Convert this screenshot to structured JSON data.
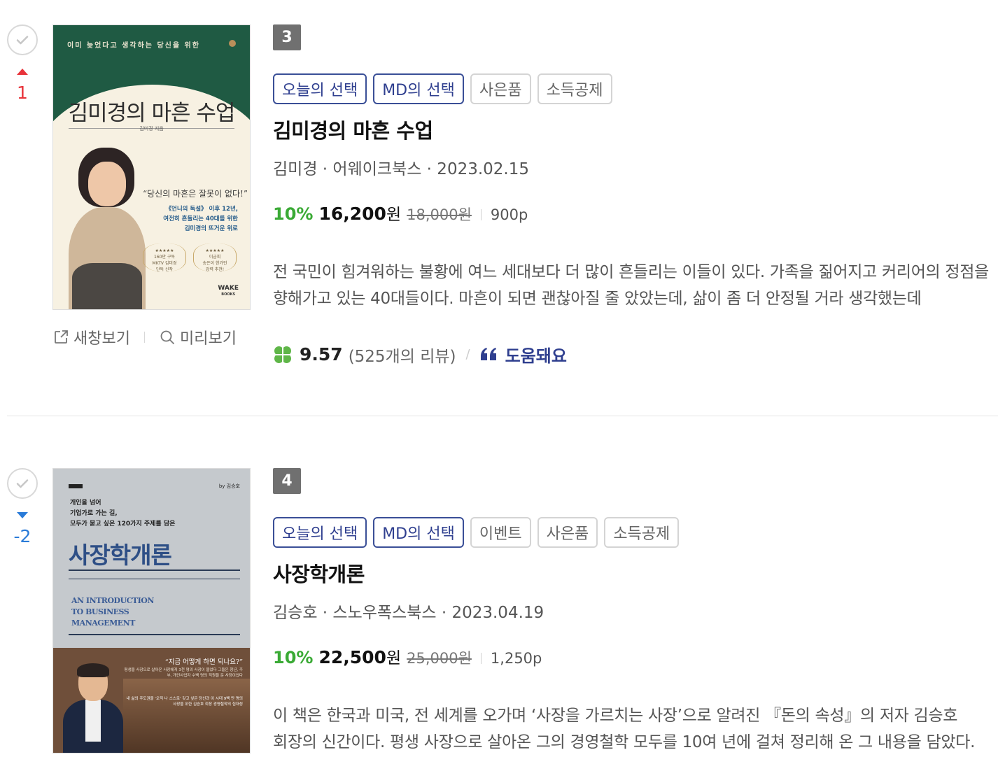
{
  "books": [
    {
      "rank": "3",
      "rank_change": "1",
      "rank_direction": "up",
      "tags": [
        "오늘의 선택",
        "MD의 선택",
        "사은품",
        "소득공제"
      ],
      "title": "김미경의 마흔 수업",
      "meta": "김미경 · 어웨이크북스 · 2023.02.15",
      "discount": "10%",
      "price": "16,200",
      "price_unit": "원",
      "original_price": "18,000원",
      "points": "900p",
      "description": "전 국민이 힘겨워하는 불황에 여느 세대보다 더 많이 흔들리는 이들이 있다. 가족을 짊어지고 커리어의 정점을 향해가고 있는 40대들이다. 마흔이 되면 괜찮아질 줄 았았는데, 삶이 좀 더 안정될 거라 생각했는데",
      "score": "9.57",
      "review_count": "(525개의 리뷰)",
      "helpful_label": "도움돼요",
      "actions": {
        "new_window": "새창보기",
        "preview": "미리보기"
      },
      "cover": {
        "top_text": "이미 늦었다고 생각하는 당신을 위한",
        "title": "김미경의 마흔 수업",
        "author_small": "김미경 지음",
        "quote": "“당신의 마흔은 잘못이 없다!”",
        "sub_lines": [
          "《언니의 독설》 이후 12년,",
          "여전히 흔들리는 40대를 위한",
          "김미경의 뜨거운 위로"
        ],
        "badge1": [
          "★★★★★",
          "160만 구독",
          "MKTV 김미경",
          "단독 신작"
        ],
        "badge2": [
          "★★★★★",
          "이금희",
          "송은이 한가인",
          "강력 추천!"
        ],
        "publisher": [
          "WAKE",
          "BOOKS"
        ]
      }
    },
    {
      "rank": "4",
      "rank_change": "-2",
      "rank_direction": "down",
      "tags": [
        "오늘의 선택",
        "MD의 선택",
        "이벤트",
        "사은품",
        "소득공제"
      ],
      "title": "사장학개론",
      "meta": "김승호 · 스노우폭스북스 · 2023.04.19",
      "discount": "10%",
      "price": "22,500",
      "price_unit": "원",
      "original_price": "25,000원",
      "points": "1,250p",
      "description": "이 책은 한국과 미국, 전 세계를 오가며 ‘사장을 가르치는 사장’으로 알려진 『돈의 속성』의 저자 김승호 회장의 신간이다. 평생 사장으로 살아온 그의 경영철학 모두를 10여 년에 걸쳐 정리해 온 그 내용을 담았다.",
      "cover": {
        "by": "by 김승호",
        "intro_lines": [
          "개인을 넘어",
          "기업가로 가는 길,",
          "모두가 묻고 싶은 120가지 주제를 담은"
        ],
        "title": "사장학개론",
        "english_lines": [
          "AN INTRODUCTION",
          "TO BUSINESS",
          "MANAGEMENT"
        ],
        "quote": "“지금 어떻게 하면 되나요?”",
        "quote_sub": "평생을 사장으로 살아온 사장에게 3천 명의 사장이 물었다 그들은 청년, 주부, 개인사업자 수백 명의 직원을 둔 사장이었다",
        "quote_sub2": "내 삶의 주도권을 ‘오직 나 스스로’ 갖고 싶은 당신과 이 시대 9백 만 명의 사장을 위한 김승호 회장 경영철학의 집대성"
      }
    }
  ],
  "colors": {
    "rank_up": "#e8333a",
    "rank_down": "#2a7bd8",
    "discount": "#3aaa35",
    "tag_blue": "#2f3f8f",
    "clover": "#5fb648"
  },
  "icons": {
    "check": "check-icon",
    "new_window": "external-link-icon",
    "preview": "search-icon",
    "clover": "clover-icon",
    "helpful": "quote-icon"
  }
}
